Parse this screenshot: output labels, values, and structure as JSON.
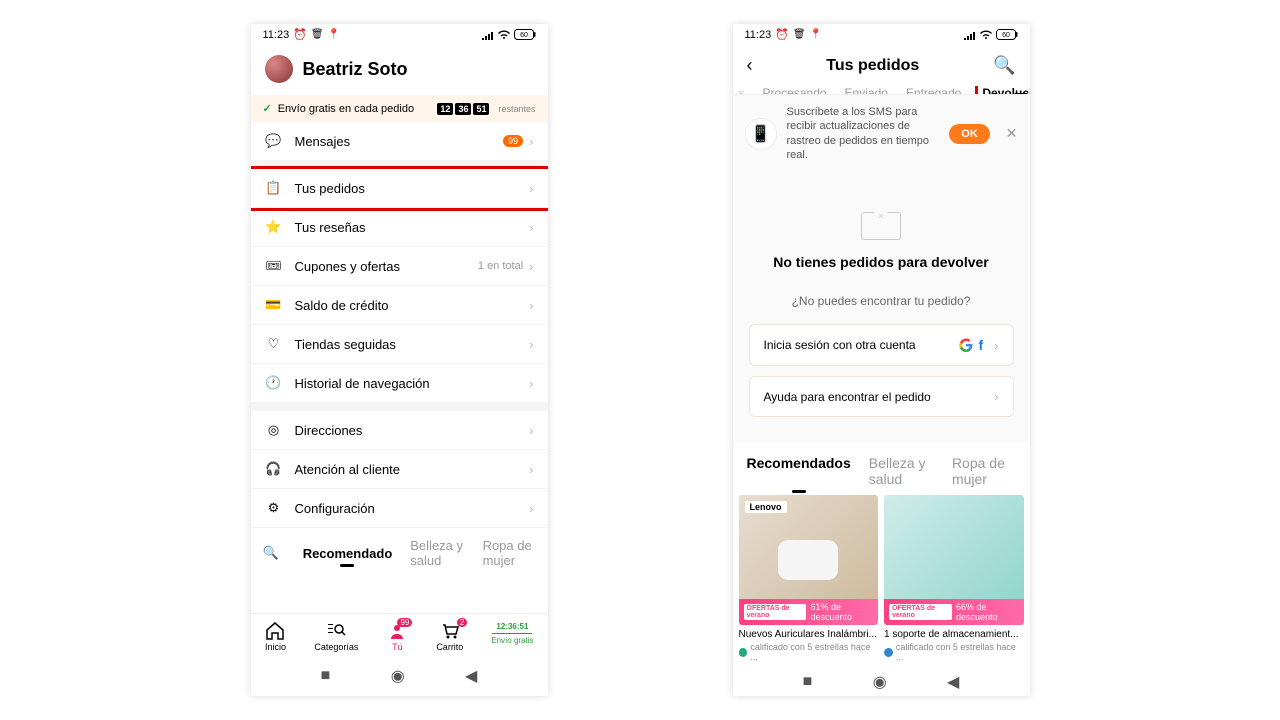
{
  "status": {
    "time": "11:23",
    "battery": "60"
  },
  "phone1": {
    "profile_name": "Beatriz Soto",
    "banner_text": "Envío gratis en cada pedido",
    "countdown": [
      "12",
      "36",
      "51"
    ],
    "remaining": "restantes",
    "menu": {
      "mensajes": "Mensajes",
      "mensajes_badge": "99",
      "pedidos": "Tus pedidos",
      "resenas": "Tus reseñas",
      "cupones": "Cupones y ofertas",
      "cupones_extra": "1 en total",
      "saldo": "Saldo de crédito",
      "tiendas": "Tiendas seguidas",
      "historial": "Historial de navegación",
      "direcciones": "Direcciones",
      "atencion": "Atención al cliente",
      "config": "Configuración"
    },
    "rec_tabs": {
      "recomendado": "Recomendado",
      "belleza": "Belleza y salud",
      "ropa": "Ropa de mujer"
    },
    "bottom": {
      "inicio": "Inicio",
      "categorias": "Categorías",
      "tu": "Tú",
      "tu_badge": "99",
      "carrito": "Carrito",
      "carrito_badge": "2",
      "cart_time": "12:36:51",
      "envio": "Envío gratis"
    }
  },
  "phone2": {
    "title": "Tus pedidos",
    "tabs": {
      "partial": "s",
      "procesando": "Procesando",
      "enviado": "Enviado",
      "entregado": "Entregado",
      "devoluciones": "Devoluciones"
    },
    "sms_text": "Suscríbete a los SMS para recibir actualizaciones de rastreo de pedidos en tiempo real.",
    "ok": "OK",
    "empty_title": "No tienes pedidos para devolver",
    "empty_sub": "¿No puedes encontrar tu pedido?",
    "login_text": "Inicia sesión con otra cuenta",
    "help_text": "Ayuda para encontrar el pedido",
    "rec_tabs": {
      "recomendados": "Recomendados",
      "belleza": "Belleza y salud",
      "ropa": "Ropa de mujer"
    },
    "products": [
      {
        "brand": "Lenovo",
        "discount": "61% de descuento",
        "tag": "OFERTAS de verano",
        "title": "Nuevos Auriculares Inalámbri...",
        "rating": "calificado con 5 estrellas hace ..."
      },
      {
        "brand": "",
        "discount": "66% de descuento",
        "tag": "OFERTAS de verano",
        "title": "1 soporte de almacenamient...",
        "rating": "calificado con 5 estrellas hace ..."
      }
    ]
  }
}
